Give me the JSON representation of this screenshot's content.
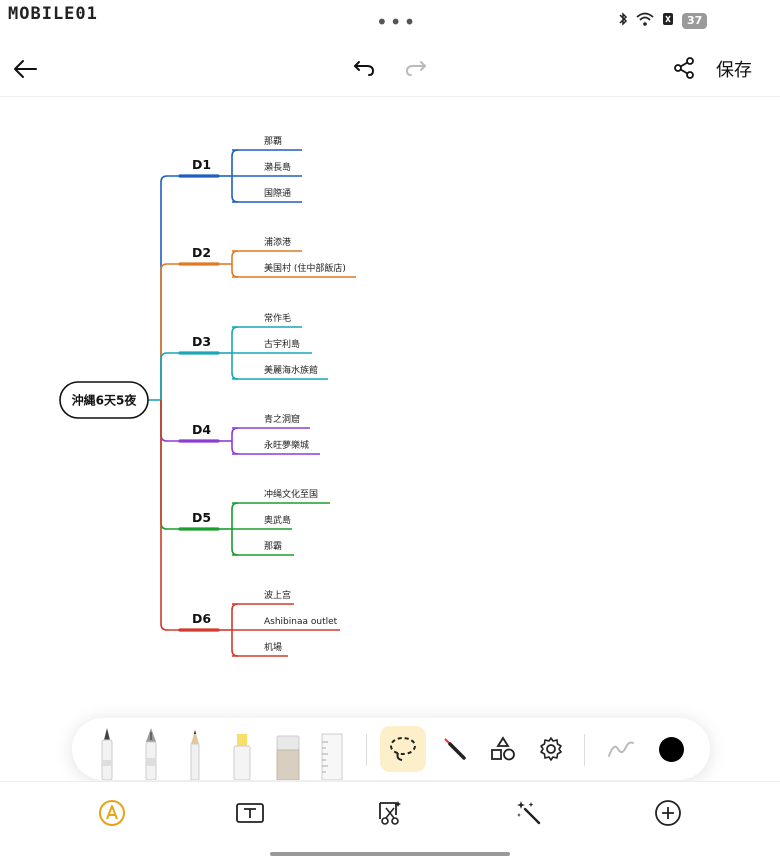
{
  "status_bar": {
    "watermark": "MOBILE01",
    "battery": "37",
    "icons": [
      "bluetooth-icon",
      "wifi-icon",
      "sim-off-icon",
      "battery-icon"
    ]
  },
  "toolbar": {
    "save_label": "保存",
    "icons": [
      "back-arrow-icon",
      "undo-icon",
      "redo-icon",
      "share-icon"
    ]
  },
  "mindmap": {
    "root": "沖縄6天5夜",
    "days": [
      {
        "label": "D1",
        "color": "#1f5fc4",
        "items": [
          "那覇",
          "瀨長島",
          "国際通"
        ]
      },
      {
        "label": "D2",
        "color": "#e07a22",
        "items": [
          "浦添港",
          "美国村 (住中部飯店)"
        ]
      },
      {
        "label": "D3",
        "color": "#1aa6b7",
        "items": [
          "常作毛",
          "古宇利島",
          "美麗海水族館"
        ]
      },
      {
        "label": "D4",
        "color": "#8e3bd6",
        "items": [
          "青之洞窟",
          "永旺夢樂城"
        ]
      },
      {
        "label": "D5",
        "color": "#1a9e2e",
        "items": [
          "冲绳文化至国",
          "奥武島",
          "那霸"
        ]
      },
      {
        "label": "D6",
        "color": "#d23a2a",
        "items": [
          "波上宫",
          "Ashibinaa outlet",
          "机場"
        ]
      }
    ]
  },
  "pen_toolbar": {
    "tools": [
      "ballpoint-pen-icon",
      "fountain-pen-icon",
      "pencil-icon",
      "highlighter-icon",
      "eraser-icon",
      "ruler-icon",
      "lasso-icon",
      "laser-pointer-icon",
      "shapes-icon",
      "settings-icon",
      "stroke-preview-icon",
      "color-picker-icon"
    ],
    "selected": "lasso-icon",
    "accent": "#fcefc9",
    "current_color": "#000000"
  },
  "bottom_nav": {
    "items": [
      "pen-mode-icon",
      "text-box-icon",
      "select-crop-icon",
      "magic-wand-icon",
      "add-icon"
    ],
    "active_color": "#e8a317"
  }
}
